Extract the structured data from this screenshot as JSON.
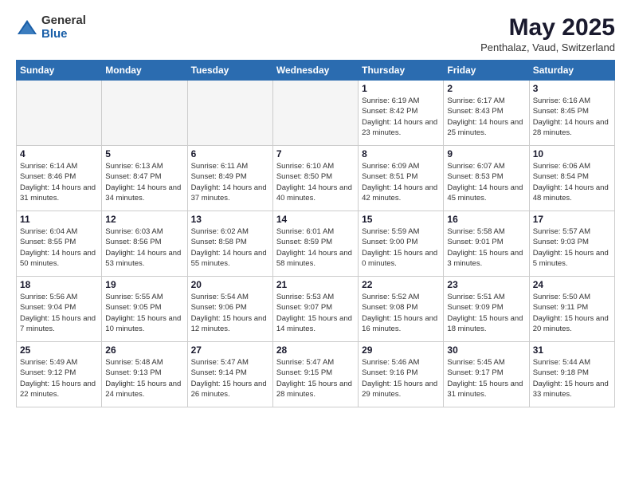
{
  "logo": {
    "general": "General",
    "blue": "Blue"
  },
  "header": {
    "title": "May 2025",
    "subtitle": "Penthalaz, Vaud, Switzerland"
  },
  "days_of_week": [
    "Sunday",
    "Monday",
    "Tuesday",
    "Wednesday",
    "Thursday",
    "Friday",
    "Saturday"
  ],
  "weeks": [
    [
      {
        "day": "",
        "empty": true
      },
      {
        "day": "",
        "empty": true
      },
      {
        "day": "",
        "empty": true
      },
      {
        "day": "",
        "empty": true
      },
      {
        "day": "1",
        "sunrise": "6:19 AM",
        "sunset": "8:42 PM",
        "daylight": "14 hours and 23 minutes."
      },
      {
        "day": "2",
        "sunrise": "6:17 AM",
        "sunset": "8:43 PM",
        "daylight": "14 hours and 25 minutes."
      },
      {
        "day": "3",
        "sunrise": "6:16 AM",
        "sunset": "8:45 PM",
        "daylight": "14 hours and 28 minutes."
      }
    ],
    [
      {
        "day": "4",
        "sunrise": "6:14 AM",
        "sunset": "8:46 PM",
        "daylight": "14 hours and 31 minutes."
      },
      {
        "day": "5",
        "sunrise": "6:13 AM",
        "sunset": "8:47 PM",
        "daylight": "14 hours and 34 minutes."
      },
      {
        "day": "6",
        "sunrise": "6:11 AM",
        "sunset": "8:49 PM",
        "daylight": "14 hours and 37 minutes."
      },
      {
        "day": "7",
        "sunrise": "6:10 AM",
        "sunset": "8:50 PM",
        "daylight": "14 hours and 40 minutes."
      },
      {
        "day": "8",
        "sunrise": "6:09 AM",
        "sunset": "8:51 PM",
        "daylight": "14 hours and 42 minutes."
      },
      {
        "day": "9",
        "sunrise": "6:07 AM",
        "sunset": "8:53 PM",
        "daylight": "14 hours and 45 minutes."
      },
      {
        "day": "10",
        "sunrise": "6:06 AM",
        "sunset": "8:54 PM",
        "daylight": "14 hours and 48 minutes."
      }
    ],
    [
      {
        "day": "11",
        "sunrise": "6:04 AM",
        "sunset": "8:55 PM",
        "daylight": "14 hours and 50 minutes."
      },
      {
        "day": "12",
        "sunrise": "6:03 AM",
        "sunset": "8:56 PM",
        "daylight": "14 hours and 53 minutes."
      },
      {
        "day": "13",
        "sunrise": "6:02 AM",
        "sunset": "8:58 PM",
        "daylight": "14 hours and 55 minutes."
      },
      {
        "day": "14",
        "sunrise": "6:01 AM",
        "sunset": "8:59 PM",
        "daylight": "14 hours and 58 minutes."
      },
      {
        "day": "15",
        "sunrise": "5:59 AM",
        "sunset": "9:00 PM",
        "daylight": "15 hours and 0 minutes."
      },
      {
        "day": "16",
        "sunrise": "5:58 AM",
        "sunset": "9:01 PM",
        "daylight": "15 hours and 3 minutes."
      },
      {
        "day": "17",
        "sunrise": "5:57 AM",
        "sunset": "9:03 PM",
        "daylight": "15 hours and 5 minutes."
      }
    ],
    [
      {
        "day": "18",
        "sunrise": "5:56 AM",
        "sunset": "9:04 PM",
        "daylight": "15 hours and 7 minutes."
      },
      {
        "day": "19",
        "sunrise": "5:55 AM",
        "sunset": "9:05 PM",
        "daylight": "15 hours and 10 minutes."
      },
      {
        "day": "20",
        "sunrise": "5:54 AM",
        "sunset": "9:06 PM",
        "daylight": "15 hours and 12 minutes."
      },
      {
        "day": "21",
        "sunrise": "5:53 AM",
        "sunset": "9:07 PM",
        "daylight": "15 hours and 14 minutes."
      },
      {
        "day": "22",
        "sunrise": "5:52 AM",
        "sunset": "9:08 PM",
        "daylight": "15 hours and 16 minutes."
      },
      {
        "day": "23",
        "sunrise": "5:51 AM",
        "sunset": "9:09 PM",
        "daylight": "15 hours and 18 minutes."
      },
      {
        "day": "24",
        "sunrise": "5:50 AM",
        "sunset": "9:11 PM",
        "daylight": "15 hours and 20 minutes."
      }
    ],
    [
      {
        "day": "25",
        "sunrise": "5:49 AM",
        "sunset": "9:12 PM",
        "daylight": "15 hours and 22 minutes."
      },
      {
        "day": "26",
        "sunrise": "5:48 AM",
        "sunset": "9:13 PM",
        "daylight": "15 hours and 24 minutes."
      },
      {
        "day": "27",
        "sunrise": "5:47 AM",
        "sunset": "9:14 PM",
        "daylight": "15 hours and 26 minutes."
      },
      {
        "day": "28",
        "sunrise": "5:47 AM",
        "sunset": "9:15 PM",
        "daylight": "15 hours and 28 minutes."
      },
      {
        "day": "29",
        "sunrise": "5:46 AM",
        "sunset": "9:16 PM",
        "daylight": "15 hours and 29 minutes."
      },
      {
        "day": "30",
        "sunrise": "5:45 AM",
        "sunset": "9:17 PM",
        "daylight": "15 hours and 31 minutes."
      },
      {
        "day": "31",
        "sunrise": "5:44 AM",
        "sunset": "9:18 PM",
        "daylight": "15 hours and 33 minutes."
      }
    ]
  ],
  "labels": {
    "sunrise": "Sunrise: ",
    "sunset": "Sunset: ",
    "daylight": "Daylight: "
  }
}
